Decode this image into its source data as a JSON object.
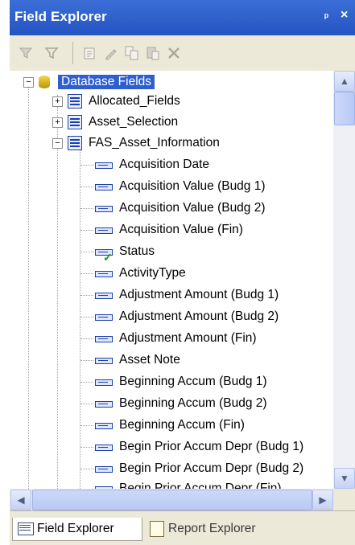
{
  "window": {
    "title": "Field Explorer",
    "pin_glyph": " р",
    "close_glyph": "×"
  },
  "toolbar": {
    "icons": [
      "filter-icon",
      "refresh-icon",
      "edit-icon",
      "rename-icon",
      "copy-icon",
      "paste-icon",
      "delete-icon"
    ]
  },
  "tree": {
    "root": {
      "label": "Database Fields"
    },
    "tables": [
      {
        "label": "Allocated_Fields",
        "expanded": false
      },
      {
        "label": "Asset_Selection",
        "expanded": false
      },
      {
        "label": "FAS_Asset_Information",
        "expanded": true
      }
    ],
    "fields": [
      {
        "label": "Acquisition Date"
      },
      {
        "label": "Acquisition Value (Budg 1)"
      },
      {
        "label": "Acquisition Value (Budg 2)"
      },
      {
        "label": "Acquisition Value (Fin)"
      },
      {
        "label": "Status",
        "checked": true
      },
      {
        "label": "ActivityType"
      },
      {
        "label": "Adjustment Amount (Budg 1)"
      },
      {
        "label": "Adjustment Amount (Budg 2)"
      },
      {
        "label": "Adjustment Amount (Fin)"
      },
      {
        "label": "Asset Note"
      },
      {
        "label": "Beginning Accum (Budg 1)"
      },
      {
        "label": "Beginning Accum (Budg 2)"
      },
      {
        "label": "Beginning Accum (Fin)"
      },
      {
        "label": "Begin Prior Accum Depr (Budg 1)"
      },
      {
        "label": "Begin Prior Accum Depr (Budg 2)"
      },
      {
        "label": "Begin Prior Accum Depr (Fin)"
      }
    ]
  },
  "tabs": [
    {
      "label": "Field Explorer",
      "active": true
    },
    {
      "label": "Report Explorer",
      "active": false
    }
  ],
  "colors": {
    "title_bar": "#2453c2",
    "selection": "#2f5fcf",
    "check": "#1a9a1a"
  }
}
